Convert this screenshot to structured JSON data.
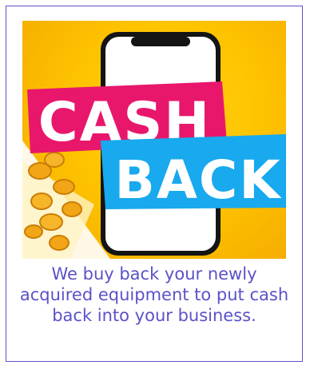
{
  "promo": {
    "banner_word_1": "CASH",
    "banner_word_2": "BACK",
    "caption": "We buy back your newly acquired equipment to put cash back into your business."
  },
  "colors": {
    "border": "#5a52c8",
    "caption_text": "#5a52c8",
    "banner_background": "#ffc400",
    "cash_ribbon": "#e8176c",
    "back_ribbon": "#18a9ee",
    "phone_frame": "#111111",
    "coin": "#f2a516"
  },
  "icons": [
    "smartphone-icon",
    "coin-icon"
  ]
}
